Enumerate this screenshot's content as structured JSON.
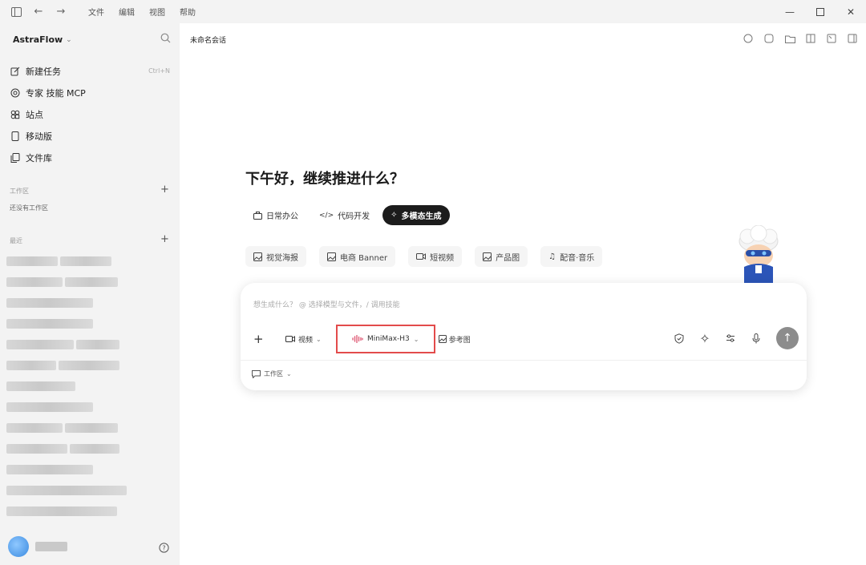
{
  "window": {
    "menus": [
      "文件",
      "编辑",
      "视图",
      "帮助"
    ]
  },
  "sidebar": {
    "brand": "AstraFlow",
    "nav": [
      {
        "label": "新建任务",
        "shortcut": "Ctrl+N",
        "icon": "edit-icon"
      },
      {
        "label": "专家 技能 MCP",
        "shortcut": "",
        "icon": "target-icon"
      },
      {
        "label": "站点",
        "shortcut": "",
        "icon": "sites-icon"
      },
      {
        "label": "移动版",
        "shortcut": "",
        "icon": "mobile-icon"
      },
      {
        "label": "文件库",
        "shortcut": "",
        "icon": "files-icon"
      }
    ],
    "workspace": {
      "title": "工作区",
      "empty": "还没有工作区"
    },
    "recent": {
      "title": "最近"
    }
  },
  "main": {
    "session_title": "未命名会话",
    "greeting": "下午好，继续推进什么？",
    "modes": [
      {
        "label": "日常办公",
        "active": false
      },
      {
        "label": "代码开发",
        "active": false
      },
      {
        "label": "多模态生成",
        "active": true
      }
    ],
    "chips": [
      "视觉海报",
      "电商 Banner",
      "短视频",
      "产品图",
      "配音·音乐"
    ],
    "composer": {
      "placeholder": "想生成什么？ @ 选择模型与文件，/ 调用技能",
      "video_label": "视频",
      "model_label": "MiniMax-H3",
      "ref_label": "参考图",
      "workspace_label": "工作区"
    }
  },
  "colors": {
    "accent_dark": "#1c1c1c",
    "highlight_border": "#e34b4b",
    "sidebar_bg": "#f3f3f3",
    "send_button": "#8c8c8c"
  }
}
